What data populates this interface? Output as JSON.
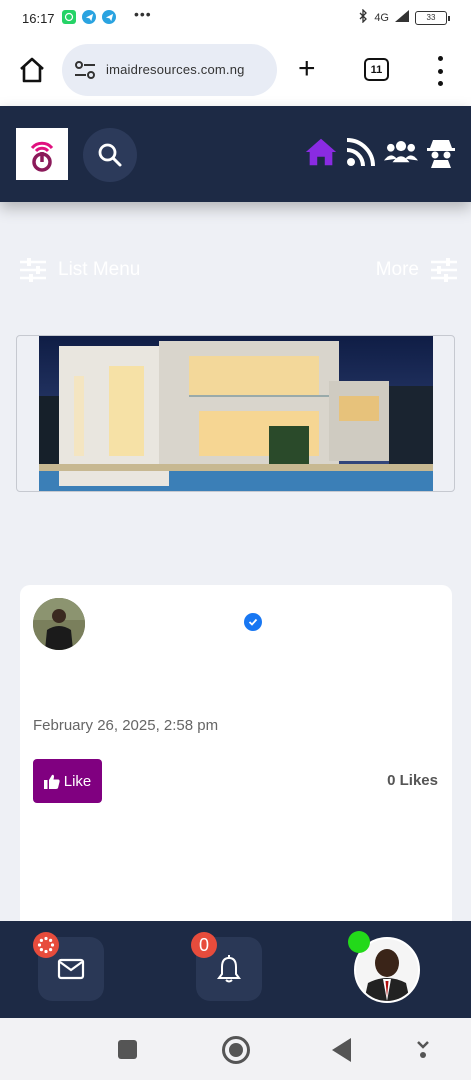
{
  "status_bar": {
    "time": "16:17",
    "network": "4G",
    "battery": "33"
  },
  "browser": {
    "url": "imaidresources.com.ng",
    "tab_count": "11"
  },
  "site_header": {
    "nav_icons": [
      "home-icon",
      "rss-feed-icon",
      "users-icon",
      "incognito-icon"
    ],
    "accent_color": "#8a2be2"
  },
  "menu_row": {
    "list_menu_label": "List Menu",
    "more_label": "More"
  },
  "post": {
    "date": "February 26, 2025, 2:58 pm",
    "like_label": "Like",
    "likes_count": "0 Likes"
  },
  "bottom_bar": {
    "notification_count": "0"
  },
  "colors": {
    "header_bg": "#1d2a45",
    "like_button": "#800080",
    "online_dot": "#23d91a",
    "badge": "#e74c3c"
  }
}
